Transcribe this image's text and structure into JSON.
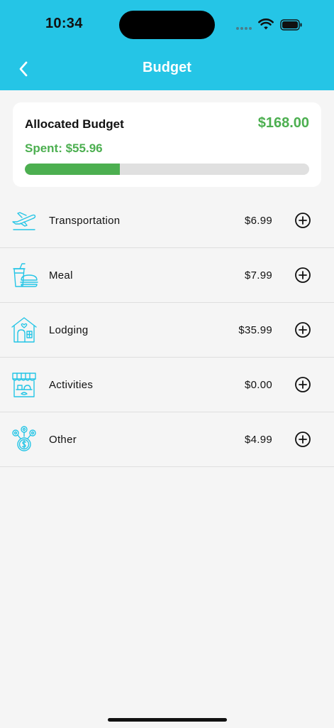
{
  "status_bar": {
    "time": "10:34"
  },
  "header": {
    "title": "Budget",
    "back_icon": "chevron-left-icon"
  },
  "budget": {
    "allocated_label": "Allocated Budget",
    "allocated_amount": "$168.00",
    "spent_label": "Spent: $55.96",
    "progress_fraction": 0.333
  },
  "categories": [
    {
      "label": "Transportation",
      "amount": "$6.99",
      "icon": "airplane-takeoff-icon"
    },
    {
      "label": "Meal",
      "amount": "$7.99",
      "icon": "drink-burger-icon"
    },
    {
      "label": "Lodging",
      "amount": "$35.99",
      "icon": "house-icon"
    },
    {
      "label": "Activities",
      "amount": "$0.00",
      "icon": "market-stall-icon"
    },
    {
      "label": "Other",
      "amount": "$4.99",
      "icon": "coins-icon"
    }
  ],
  "colors": {
    "header": "#25c5e6",
    "accent_green": "#4caf50",
    "icon_cyan": "#25c5e6"
  }
}
